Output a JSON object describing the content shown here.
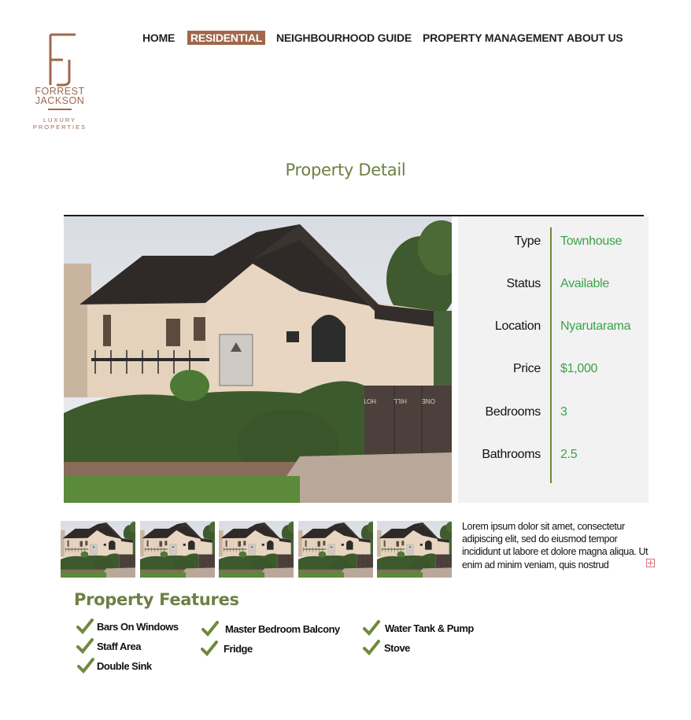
{
  "logo": {
    "monogram": "FJ",
    "name_line1": "FORREST",
    "name_line2": "JACKSON",
    "tagline_line1": "LUXURY",
    "tagline_line2": "PROPERTIES",
    "color": "#a0674b"
  },
  "nav": {
    "items": [
      {
        "label": "HOME",
        "active": false
      },
      {
        "label": "RESIDENTIAL",
        "active": true
      },
      {
        "label": "NEIGHBOURHOOD GUIDE",
        "active": false
      },
      {
        "label": "PROPERTY MANAGEMENT",
        "active": false
      },
      {
        "label": "ABOUT US",
        "active": false
      }
    ]
  },
  "page_title": "Property Detail",
  "details": [
    {
      "label": "Type",
      "value": "Townhouse"
    },
    {
      "label": "Status",
      "value": "Available"
    },
    {
      "label": "Location",
      "value": "Nyarutarama"
    },
    {
      "label": "Price",
      "value": "$1,000"
    },
    {
      "label": "Bedrooms",
      "value": "3"
    },
    {
      "label": "Bathrooms",
      "value": "2.5"
    }
  ],
  "description": "Lorem ipsum dolor sit amet, consectetur adipiscing elit, sed do eiusmod tempor incididunt ut labore et dolore magna aliqua. Ut enim ad minim veniam, quis nostrud",
  "house_sign_text": {
    "left": "ONE",
    "middle": "HILL",
    "right": "HOTEL"
  },
  "features_title": "Property Features",
  "features": [
    "Bars On Windows",
    "Master Bedroom Balcony",
    "Water Tank & Pump",
    "Staff Area",
    "Fridge",
    "Stove",
    "Double Sink"
  ],
  "colors": {
    "accent_brown": "#a0674b",
    "olive": "#6f7f45",
    "value_green": "#3aa34a",
    "check_green": "#6f8a3c",
    "panel_bg": "#f2f2f2"
  }
}
